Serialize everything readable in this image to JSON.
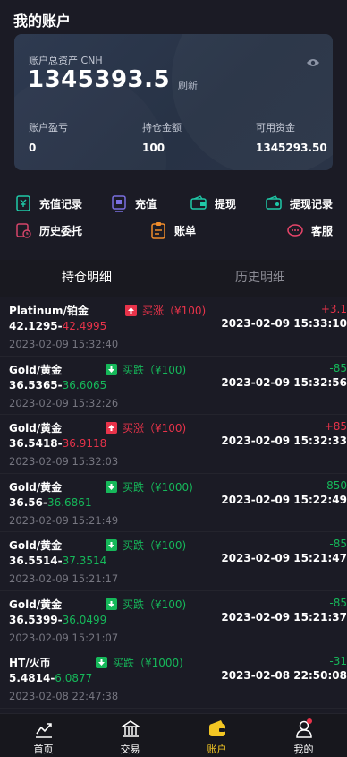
{
  "header": {
    "title": "我的账户"
  },
  "account": {
    "total_label": "账户总资产 CNH",
    "total_value": "1345393.5",
    "refresh_label": "刷新",
    "stats": [
      {
        "label": "账户盈亏",
        "value": "0"
      },
      {
        "label": "持仓金额",
        "value": "100"
      },
      {
        "label": "可用资金",
        "value": "1345293.50"
      }
    ]
  },
  "actions": [
    {
      "label": "充值记录",
      "icon": "recharge-record-icon"
    },
    {
      "label": "充值",
      "icon": "recharge-icon"
    },
    {
      "label": "提现",
      "icon": "withdraw-icon"
    },
    {
      "label": "提现记录",
      "icon": "withdraw-record-icon"
    },
    {
      "label": "历史委托",
      "icon": "history-order-icon"
    },
    {
      "label": "账单",
      "icon": "bill-icon"
    },
    {
      "label": "客服",
      "icon": "customer-service-icon"
    }
  ],
  "tabs": [
    {
      "label": "持仓明细",
      "active": true
    },
    {
      "label": "历史明细",
      "active": false
    }
  ],
  "positions": [
    {
      "name": "Platinum/铂金",
      "open": "42.1295",
      "now": "42.4995",
      "now_color": "red",
      "time": "2023-02-09 15:32:40",
      "direction": "买涨（¥100)",
      "dir_color": "red",
      "pl": "+3.1",
      "close_time": "2023-02-09 15:33:10"
    },
    {
      "name": "Gold/黄金",
      "open": "36.5365",
      "now": "36.6065",
      "now_color": "green",
      "time": "2023-02-09 15:32:26",
      "direction": "买跌（¥100)",
      "dir_color": "green",
      "pl": "-85",
      "close_time": "2023-02-09 15:32:56"
    },
    {
      "name": "Gold/黄金",
      "open": "36.5418",
      "now": "36.9118",
      "now_color": "red",
      "time": "2023-02-09 15:32:03",
      "direction": "买涨（¥100)",
      "dir_color": "red",
      "pl": "+85",
      "close_time": "2023-02-09 15:32:33"
    },
    {
      "name": "Gold/黄金",
      "open": "36.56",
      "now": "36.6861",
      "now_color": "green",
      "time": "2023-02-09 15:21:49",
      "direction": "买跌（¥1000)",
      "dir_color": "green",
      "pl": "-850",
      "close_time": "2023-02-09 15:22:49"
    },
    {
      "name": "Gold/黄金",
      "open": "36.5514",
      "now": "37.3514",
      "now_color": "green",
      "time": "2023-02-09 15:21:17",
      "direction": "买跌（¥100)",
      "dir_color": "green",
      "pl": "-85",
      "close_time": "2023-02-09 15:21:47"
    },
    {
      "name": "Gold/黄金",
      "open": "36.5399",
      "now": "36.0499",
      "now_color": "green",
      "time": "2023-02-09 15:21:07",
      "direction": "买跌（¥100)",
      "dir_color": "green",
      "pl": "-85",
      "close_time": "2023-02-09 15:21:37"
    },
    {
      "name": "HT/火币",
      "open": "5.4814",
      "now": "6.0877",
      "now_color": "green",
      "time": "2023-02-08 22:47:38",
      "direction": "买跌（¥1000)",
      "dir_color": "green",
      "pl": "-31",
      "close_time": "2023-02-08 22:50:08"
    }
  ],
  "nav": [
    {
      "label": "首页",
      "icon": "chart-trend-icon",
      "active": false
    },
    {
      "label": "交易",
      "icon": "bank-icon",
      "active": false
    },
    {
      "label": "账户",
      "icon": "wallet-icon",
      "active": true
    },
    {
      "label": "我的",
      "icon": "user-icon",
      "active": false
    }
  ],
  "colors": {
    "background": "#1b1b25",
    "card": "#2b3548",
    "accent": "#f3c623",
    "up": "#e8334a",
    "down": "#16b85a"
  }
}
